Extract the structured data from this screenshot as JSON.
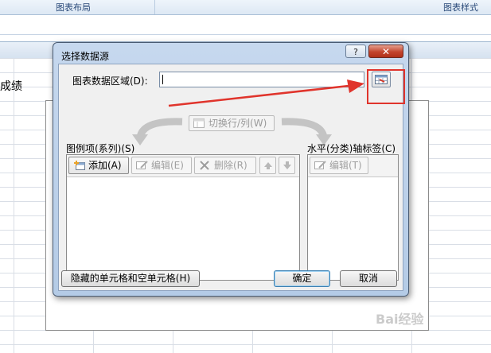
{
  "ribbon": {
    "group_layout": "图表布局",
    "group_style": "图表样式"
  },
  "sheet": {
    "partial_cell_text": "成绩"
  },
  "dialog": {
    "title": "选择数据源",
    "help_label": "?",
    "close_label": "✕",
    "range_label": "图表数据区域(D):",
    "range_value": "",
    "switch_label": "切换行/列(W)",
    "legend_label": "图例项(系列)(S)",
    "axis_label": "水平(分类)轴标签(C)",
    "add_label": "添加(A)",
    "edit_label": "编辑(E)",
    "delete_label": "删除(R)",
    "axis_edit_label": "编辑(T)",
    "hidden_cells_label": "隐藏的单元格和空单元格(H)",
    "ok_label": "确定",
    "cancel_label": "取消"
  },
  "watermark": "Bai经验",
  "colors": {
    "highlight": "#e0342c",
    "dialog_frame": "#b4cbe6"
  }
}
